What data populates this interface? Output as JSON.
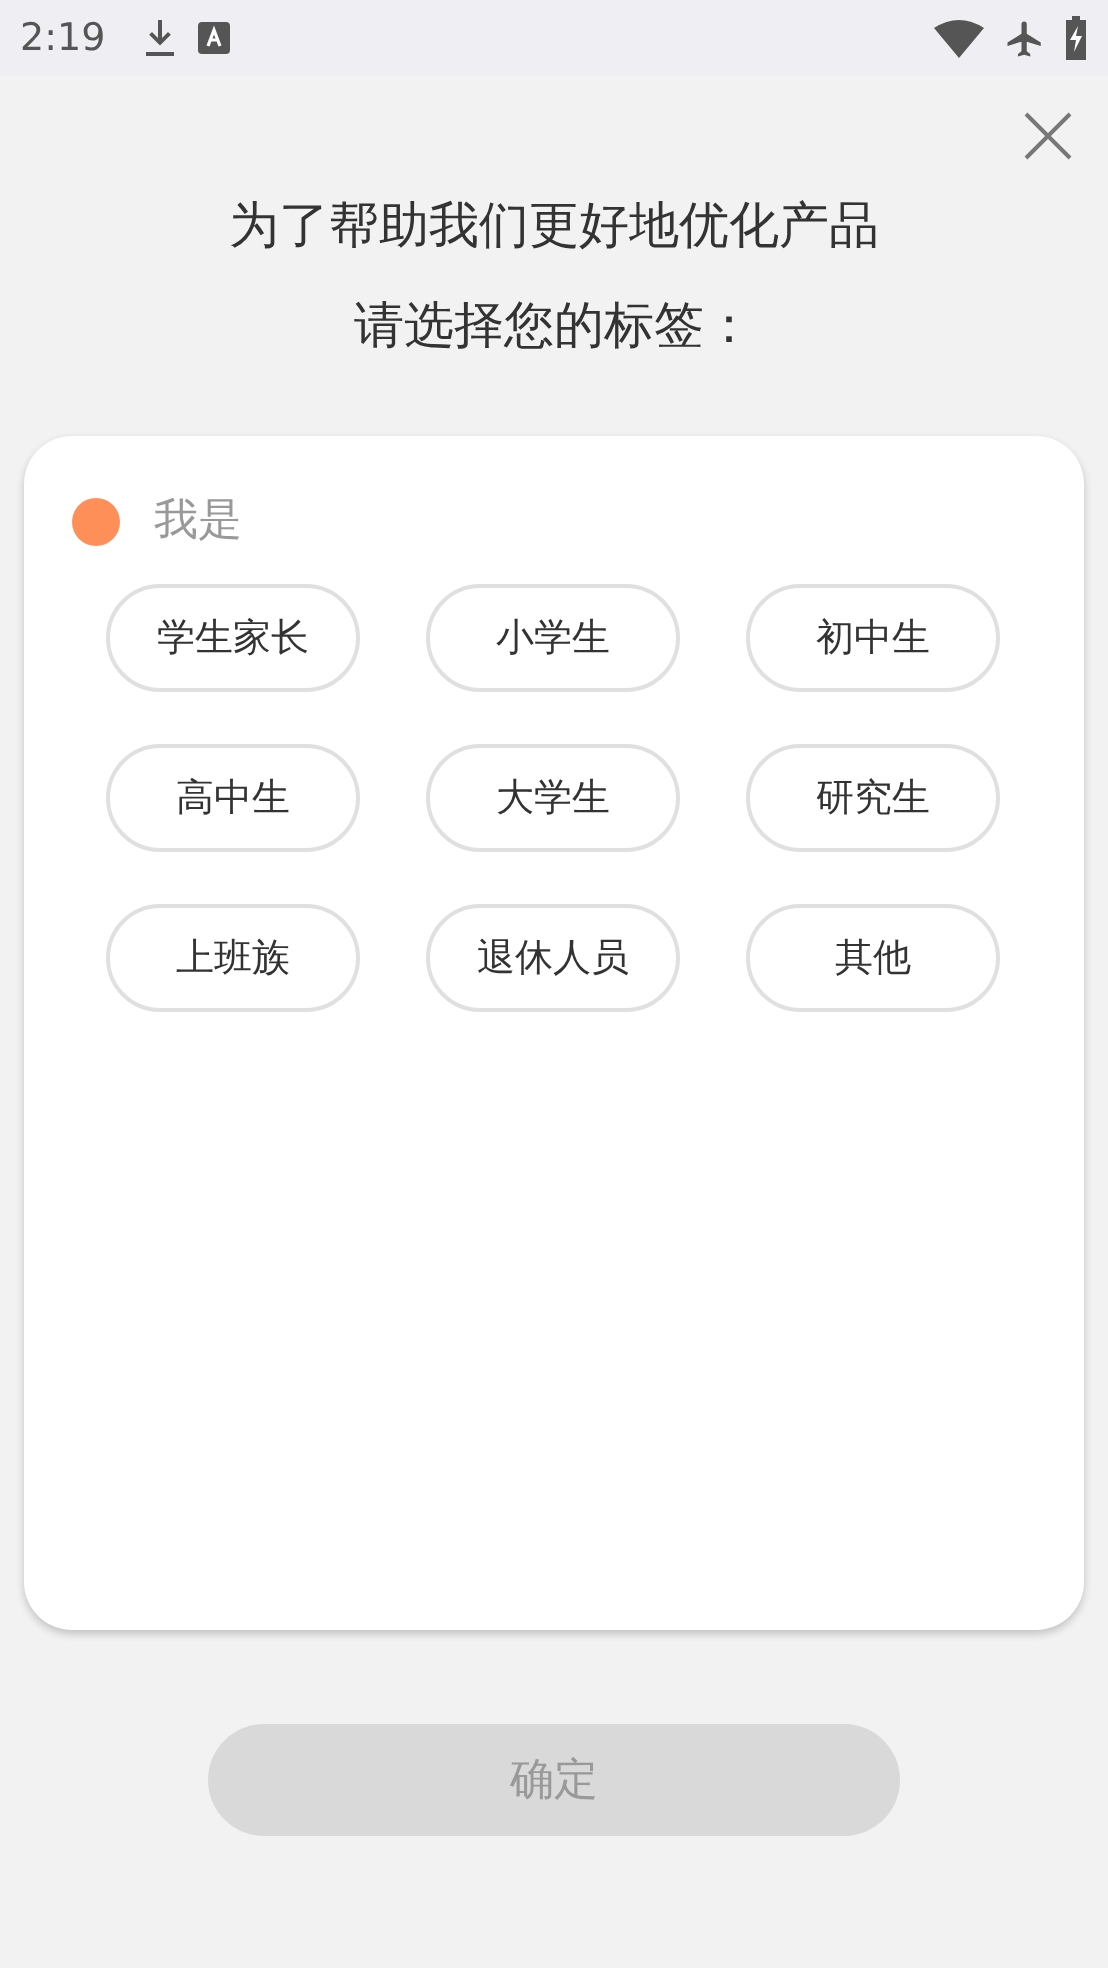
{
  "status_bar": {
    "time": "2:19"
  },
  "title_lines": [
    "为了帮助我们更好地优化产品",
    "请选择您的标签："
  ],
  "section": {
    "label": "我是",
    "color": "#ff8f59"
  },
  "tags": [
    {
      "label": "学生家长",
      "selected": false
    },
    {
      "label": "小学生",
      "selected": false
    },
    {
      "label": "初中生",
      "selected": false
    },
    {
      "label": "高中生",
      "selected": false
    },
    {
      "label": "大学生",
      "selected": false
    },
    {
      "label": "研究生",
      "selected": false
    },
    {
      "label": "上班族",
      "selected": false
    },
    {
      "label": "退休人员",
      "selected": false
    },
    {
      "label": "其他",
      "selected": false
    }
  ],
  "confirm": {
    "label": "确定",
    "disabled": true
  }
}
